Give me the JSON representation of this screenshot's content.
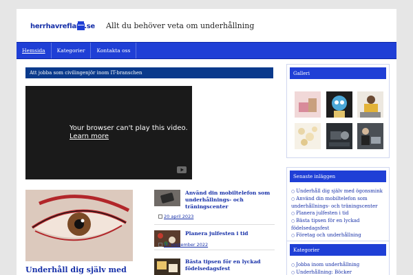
{
  "header": {
    "logo_text": "herrhavreflarn.se",
    "tagline": "Allt du behöver veta om underhållning"
  },
  "nav": {
    "items": [
      "Hemsida",
      "Kategorier",
      "Kontakta oss"
    ]
  },
  "main": {
    "post_title": "Att jobba som civilingenjör inom IT-branschen",
    "video": {
      "message": "Your browser can't play this video.",
      "learn_more": "Learn more"
    },
    "featured_title": "Underhåll dig själv med",
    "recent_posts": [
      {
        "title": "Använd din mobiltelefon som underhållnings- och träningscenter",
        "date": "20 april 2023"
      },
      {
        "title": "Planera julfesten i tid",
        "date": "17 september 2022"
      },
      {
        "title": "Bästa tipsen för en lyckad födelsedagsfest",
        "date": ""
      }
    ]
  },
  "sidebar": {
    "gallery_title": "Galleri",
    "gallery_icons": [
      "photo-icon",
      "photo-icon",
      "photo-icon",
      "photo-icon",
      "photo-icon",
      "photo-icon"
    ],
    "latest_title": "Senaste inläggen",
    "latest": [
      "Underhåll dig själv med ögonsmink",
      "Använd din mobiltelefon som underhållnings- och träningscenter",
      "Planera julfesten i tid",
      "Bästa tipsen för en lyckad födelsedagsfest",
      "Företag och underhållning"
    ],
    "categories_title": "Kategorier",
    "categories": [
      "Jobba inom underhållning",
      "Underhållning: Böcker"
    ]
  },
  "colors": {
    "brand_blue": "#1f3fd6",
    "title_bar": "#0a3a8c",
    "link": "#1730a8"
  }
}
